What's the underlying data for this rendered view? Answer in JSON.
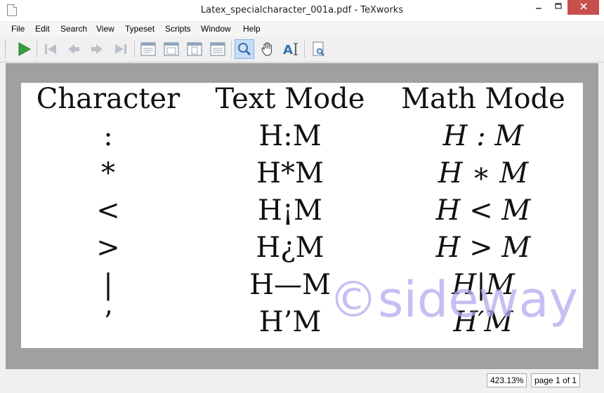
{
  "window": {
    "title": "Latex_specialcharacter_001a.pdf - TeXworks"
  },
  "menu": [
    "File",
    "Edit",
    "Search",
    "View",
    "Typeset",
    "Scripts",
    "Window",
    "Help"
  ],
  "document": {
    "headers": [
      "Character",
      "Text Mode",
      "Math Mode"
    ],
    "rows": [
      [
        ":",
        "H:M",
        "H : M"
      ],
      [
        "*",
        "H*M",
        "H ∗ M"
      ],
      [
        "<",
        "H¡M",
        "H < M"
      ],
      [
        ">",
        "H¿M",
        "H > M"
      ],
      [
        "|",
        "H—M",
        "H|M"
      ],
      [
        "’",
        "H’M",
        "H′M"
      ]
    ],
    "watermark": "©sideway"
  },
  "status": {
    "zoom": "423.13%",
    "page": "page 1 of 1"
  },
  "colors": {
    "close_button": "#c7504e",
    "active_tool": "#c5def5",
    "viewer_bg": "#a0a0a0",
    "play_icon": "#3a9e3a"
  }
}
